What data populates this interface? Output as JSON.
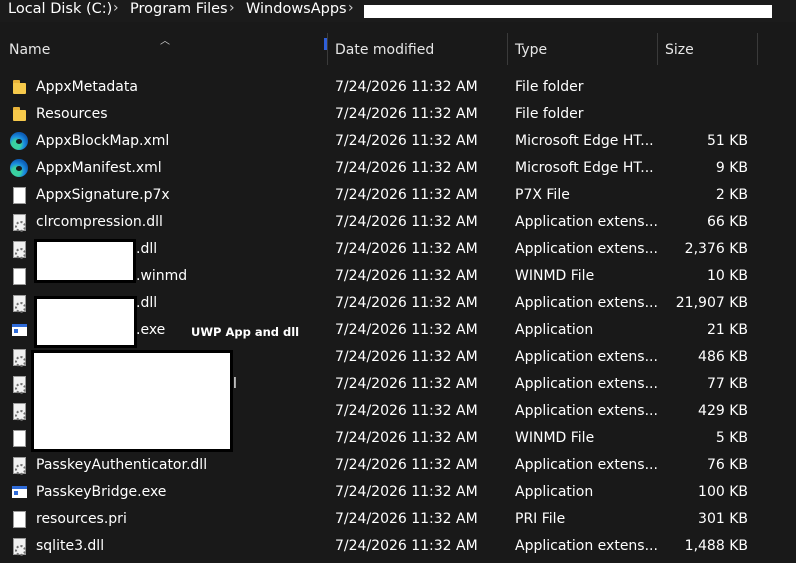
{
  "breadcrumb": {
    "items": [
      "Local Disk (C:)",
      "Program Files",
      "WindowsApps"
    ],
    "separator": "›"
  },
  "columns": {
    "name": "Name",
    "date": "Date modified",
    "type": "Type",
    "size": "Size"
  },
  "files": [
    {
      "name": "AppxMetadata",
      "date": "7/24/2026 11:32 AM",
      "type": "File folder",
      "size": "",
      "icon": "folder-icon"
    },
    {
      "name": "Resources",
      "date": "7/24/2026 11:32 AM",
      "type": "File folder",
      "size": "",
      "icon": "folder-icon"
    },
    {
      "name": "AppxBlockMap.xml",
      "date": "7/24/2026 11:32 AM",
      "type": "Microsoft Edge HT...",
      "size": "51 KB",
      "icon": "edge-icon"
    },
    {
      "name": "AppxManifest.xml",
      "date": "7/24/2026 11:32 AM",
      "type": "Microsoft Edge HT...",
      "size": "9 KB",
      "icon": "edge-icon"
    },
    {
      "name": "AppxSignature.p7x",
      "date": "7/24/2026 11:32 AM",
      "type": "P7X File",
      "size": "2 KB",
      "icon": "file-icon"
    },
    {
      "name": "clrcompression.dll",
      "date": "7/24/2026 11:32 AM",
      "type": "Application extens...",
      "size": "66 KB",
      "icon": "dll-icon"
    },
    {
      "name": ".dll",
      "date": "7/24/2026 11:32 AM",
      "type": "Application extens...",
      "size": "2,376 KB",
      "icon": "dll-icon"
    },
    {
      "name": ".winmd",
      "date": "7/24/2026 11:32 AM",
      "type": "WINMD File",
      "size": "10 KB",
      "icon": "file-icon"
    },
    {
      "name": ".dll",
      "date": "7/24/2026 11:32 AM",
      "type": "Application extens...",
      "size": "21,907 KB",
      "icon": "dll-icon"
    },
    {
      "name": ".exe",
      "date": "7/24/2026 11:32 AM",
      "type": "Application",
      "size": "21 KB",
      "icon": "exe-icon"
    },
    {
      "name": "",
      "date": "7/24/2026 11:32 AM",
      "type": "Application extens...",
      "size": "486 KB",
      "icon": "dll-icon"
    },
    {
      "name": "l",
      "date": "7/24/2026 11:32 AM",
      "type": "Application extens...",
      "size": "77 KB",
      "icon": "dll-icon"
    },
    {
      "name": "",
      "date": "7/24/2026 11:32 AM",
      "type": "Application extens...",
      "size": "429 KB",
      "icon": "dll-icon"
    },
    {
      "name": "",
      "date": "7/24/2026 11:32 AM",
      "type": "WINMD File",
      "size": "5 KB",
      "icon": "file-icon"
    },
    {
      "name": "PasskeyAuthenticator.dll",
      "date": "7/24/2026 11:32 AM",
      "type": "Application extens...",
      "size": "76 KB",
      "icon": "dll-icon"
    },
    {
      "name": "PasskeyBridge.exe",
      "date": "7/24/2026 11:32 AM",
      "type": "Application",
      "size": "100 KB",
      "icon": "exe-icon"
    },
    {
      "name": "resources.pri",
      "date": "7/24/2026 11:32 AM",
      "type": "PRI File",
      "size": "301 KB",
      "icon": "file-icon"
    },
    {
      "name": "sqlite3.dll",
      "date": "7/24/2026 11:32 AM",
      "type": "Application extens...",
      "size": "1,488 KB",
      "icon": "dll-icon"
    }
  ],
  "annotation": "UWP App and dll"
}
